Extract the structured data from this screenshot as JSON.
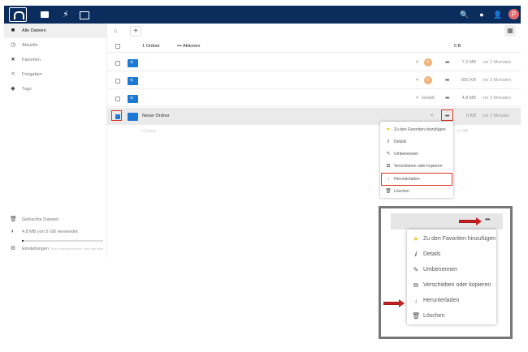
{
  "colors": {
    "topbar": "#0a2d5e",
    "folder": "#1d7ad4",
    "highlight": "#d32f2f",
    "avatar_user": "#e66c6c",
    "avatar_share": "#f0b27a"
  },
  "topbar": {
    "avatar_letter": "P",
    "icons": [
      "cloud-logo",
      "files-icon",
      "activity-icon",
      "gallery-icon",
      "search-icon",
      "bell-icon",
      "contacts-icon"
    ]
  },
  "sidebar": {
    "items": [
      {
        "label": "Alle Dateien",
        "icon": "folder-icon",
        "active": true
      },
      {
        "label": "Aktuelle",
        "icon": "clock-icon"
      },
      {
        "label": "Favoriten",
        "icon": "star-icon"
      },
      {
        "label": "Freigaben",
        "icon": "share-icon"
      },
      {
        "label": "Tags",
        "icon": "tag-icon"
      }
    ],
    "deleted": "Gelöschte Dateien",
    "storage": "4,8 MB von 5 GB verwendet",
    "storage_used": 0.02,
    "settings": "Einstellungen",
    "settings_hint": "Ihren Benutzernamen über das Web"
  },
  "files": {
    "header": {
      "count": "1 Ordner",
      "actions": "Aktionen",
      "total": "0 B"
    },
    "rows": [
      {
        "name": "",
        "share_avatar": "F",
        "size": "7,3 MB",
        "modified": "vor 2 Monaten"
      },
      {
        "name": "",
        "share_avatar": "F",
        "size": "855 KB",
        "modified": "vor 3 Monaten"
      },
      {
        "name": "",
        "share_label": "Geteilt",
        "size": "4,8 MB",
        "modified": "vor 3 Monaten"
      },
      {
        "name": "Neuer Ordner",
        "size": "0 KB",
        "modified": "vor 2 Minuten",
        "selected": true
      }
    ],
    "add_hint": "+ Ordner",
    "add_size": "12 MB"
  },
  "menu": {
    "items": [
      {
        "label": "Zu den Favoriten hinzufügen",
        "icon": "star-icon"
      },
      {
        "label": "Details",
        "icon": "info-icon"
      },
      {
        "label": "Umbenennen",
        "icon": "pencil-icon"
      },
      {
        "label": "Verschieben oder kopieren",
        "icon": "external-icon"
      },
      {
        "label": "Herunterladen",
        "icon": "download-icon",
        "highlighted": true
      },
      {
        "label": "Löschen",
        "icon": "trash-icon"
      }
    ]
  }
}
